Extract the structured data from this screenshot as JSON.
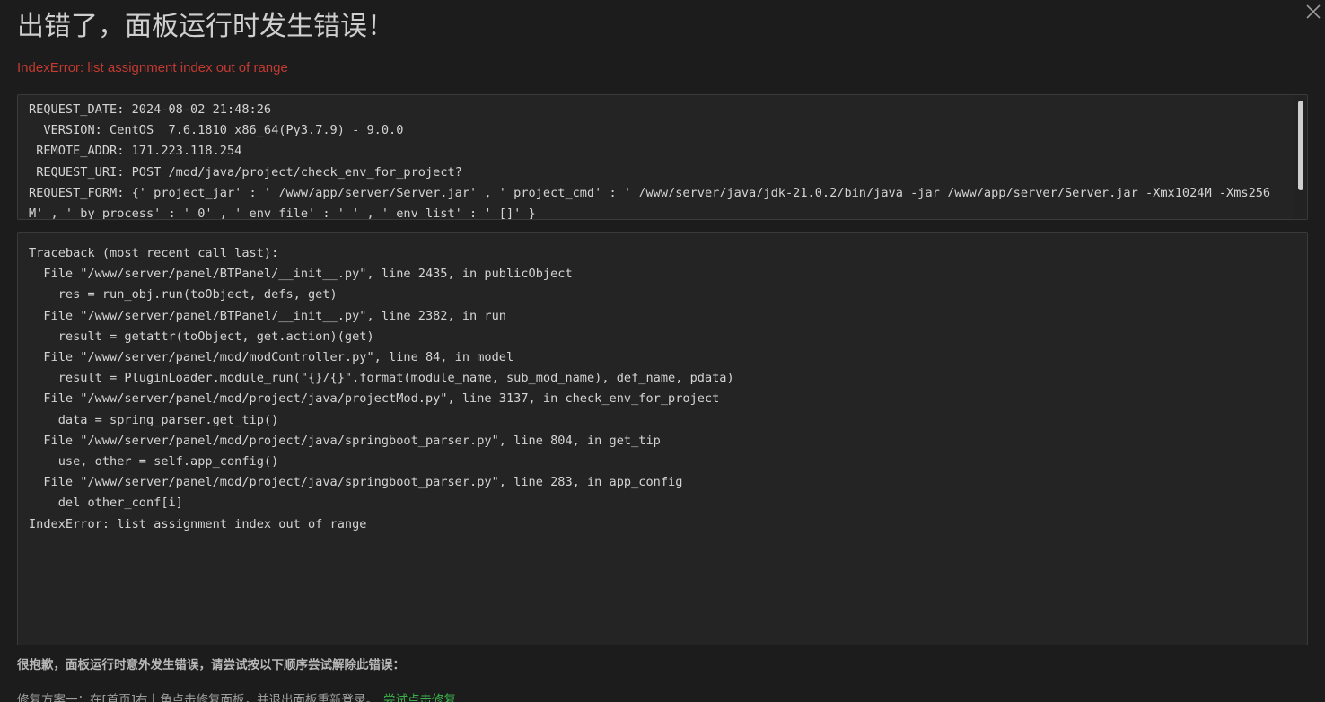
{
  "header": {
    "title": "出错了，面板运行时发生错误！",
    "error_message": "IndexError: list assignment index out of range"
  },
  "request_info": {
    "text": "REQUEST_DATE: 2024-08-02 21:48:26\n  VERSION: CentOS  7.6.1810 x86_64(Py3.7.9) - 9.0.0\n REMOTE_ADDR: 171.223.118.254\n REQUEST_URI: POST /mod/java/project/check_env_for_project?\nREQUEST_FORM: {' project_jar' : ' /www/app/server/Server.jar' , ' project_cmd' : ' /www/server/java/jdk-21.0.2/bin/java -jar /www/app/server/Server.jar -Xmx1024M -Xms256M' , ' by_process' : ' 0' , ' env_file' : ' ' , ' env_list' : ' []' }"
  },
  "traceback": {
    "text": "Traceback (most recent call last):\n  File \"/www/server/panel/BTPanel/__init__.py\", line 2435, in publicObject\n    res = run_obj.run(toObject, defs, get)\n  File \"/www/server/panel/BTPanel/__init__.py\", line 2382, in run\n    result = getattr(toObject, get.action)(get)\n  File \"/www/server/panel/mod/modController.py\", line 84, in model\n    result = PluginLoader.module_run(\"{}/{}\".format(module_name, sub_mod_name), def_name, pdata)\n  File \"/www/server/panel/mod/project/java/projectMod.py\", line 3137, in check_env_for_project\n    data = spring_parser.get_tip()\n  File \"/www/server/panel/mod/project/java/springboot_parser.py\", line 804, in get_tip\n    use, other = self.app_config()\n  File \"/www/server/panel/mod/project/java/springboot_parser.py\", line 283, in app_config\n    del other_conf[i]\nIndexError: list assignment index out of range"
  },
  "help": {
    "sorry_text": "很抱歉，面板运行时意外发生错误，请尝试按以下顺序尝试解除此错误：",
    "fix_option_one": "修复方案一：在[首页]右上角点击修复面板，并退出面板重新登录。",
    "fix_link": "尝试点击修复"
  },
  "colors": {
    "background": "#1c1c1c",
    "error_red": "#c23a32",
    "link_green": "#3cb44b"
  },
  "icons": {
    "close": "close-icon"
  }
}
